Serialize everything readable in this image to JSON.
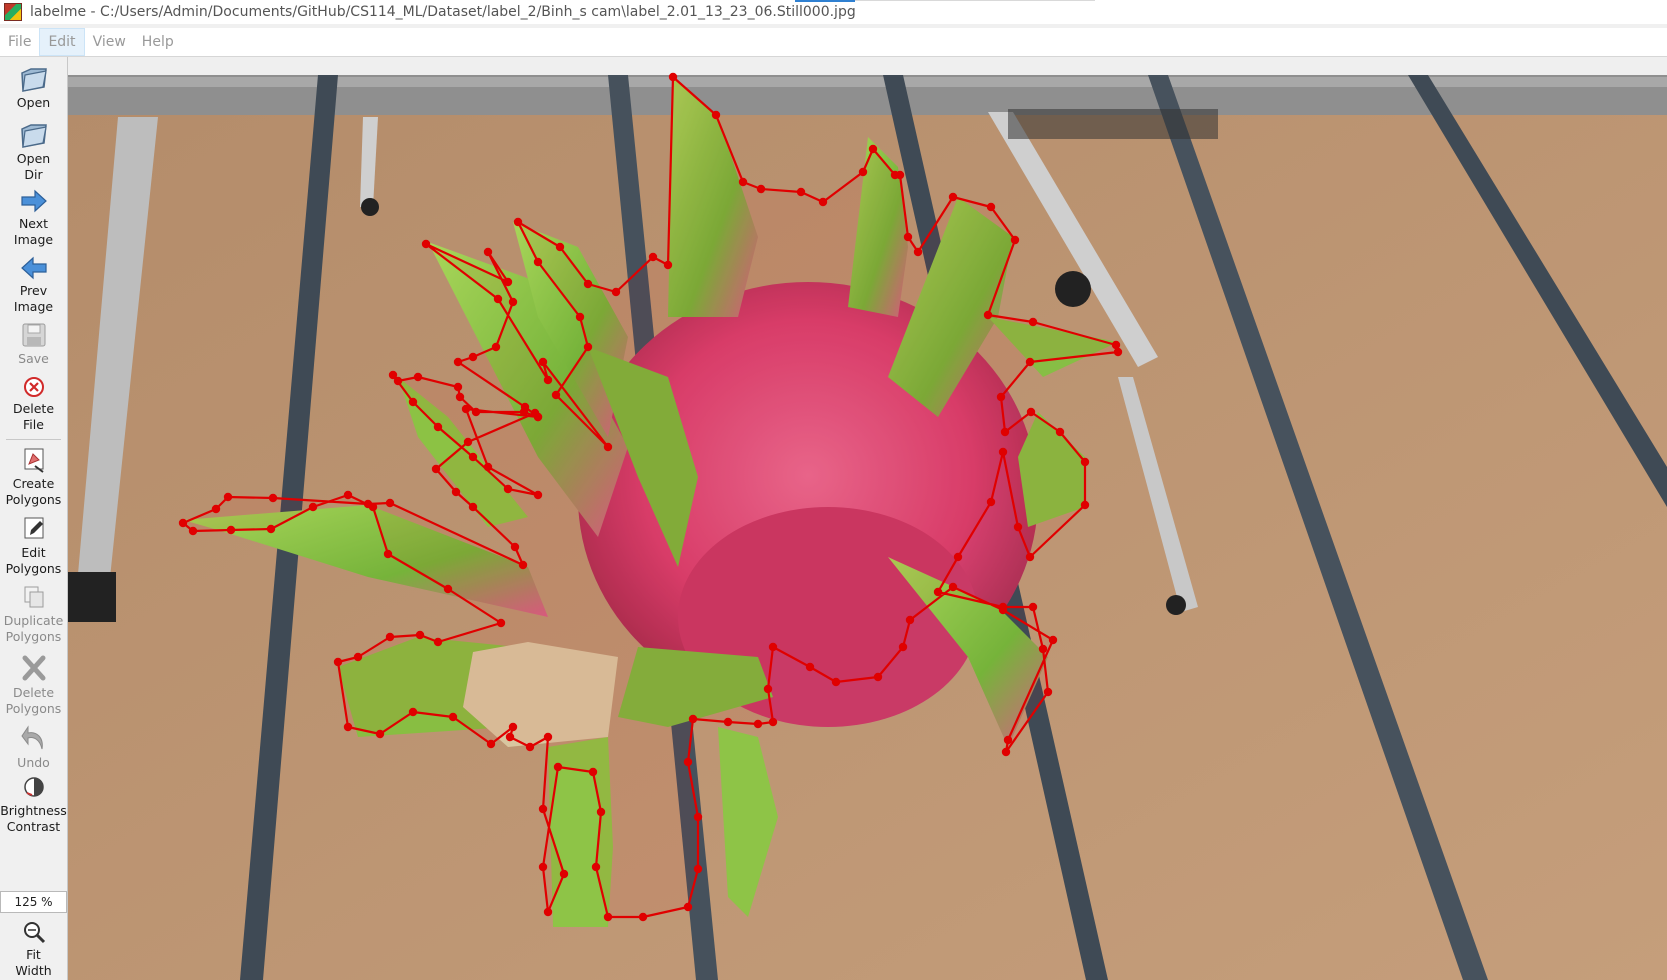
{
  "window": {
    "title": "labelme - C:/Users/Admin/Documents/GitHub/CS114_ML/Dataset/label_2/Binh_s cam\\label_2.01_13_23_06.Still000.jpg"
  },
  "menu": [
    "File",
    "Edit",
    "View",
    "Help"
  ],
  "toolbar": {
    "open": "Open",
    "open_dir": [
      "Open",
      "Dir"
    ],
    "next_image": [
      "Next",
      "Image"
    ],
    "prev_image": [
      "Prev",
      "Image"
    ],
    "save": "Save",
    "delete_file": [
      "Delete",
      "File"
    ],
    "create_polygons": [
      "Create",
      "Polygons"
    ],
    "edit_polygons": [
      "Edit",
      "Polygons"
    ],
    "duplicate_polygons": [
      "Duplicate",
      "Polygons"
    ],
    "delete_polygons": [
      "Delete",
      "Polygons"
    ],
    "undo": "Undo",
    "brightness_contrast": [
      "Brightness",
      "Contrast"
    ],
    "zoom": "125 %",
    "fit_width": [
      "Fit",
      "Width"
    ]
  },
  "colors": {
    "polygon": "#e00000",
    "soil": "#b98f6b",
    "fruit": "#e0457a",
    "bract": "#8ec63f"
  }
}
